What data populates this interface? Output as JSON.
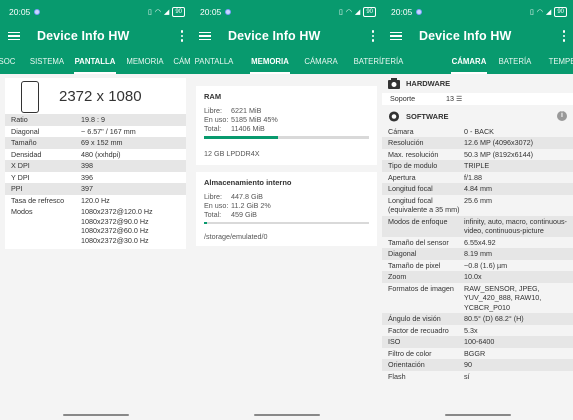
{
  "status": {
    "time": "20:05",
    "battery": "90"
  },
  "app_title": "Device Info HW",
  "panel1": {
    "tabs": [
      "SOC",
      "SISTEMA",
      "PANTALLA",
      "MEMORIA",
      "CÁMERA"
    ],
    "resolution": "2372 x 1080",
    "rows": [
      {
        "k": "Ratio",
        "v": "19.8 : 9"
      },
      {
        "k": "Diagonal",
        "v": "~ 6.57\" / 167 mm"
      },
      {
        "k": "Tamaño",
        "v": "69 x 152 mm"
      },
      {
        "k": "Densidad",
        "v": "480 (xxhdpi)"
      },
      {
        "k": "X DPI",
        "v": "398"
      },
      {
        "k": "Y DPI",
        "v": "396"
      },
      {
        "k": "PPI",
        "v": "397"
      },
      {
        "k": "Tasa de refresco",
        "v": "120.0 Hz"
      }
    ],
    "modes_label": "Modos",
    "modes": [
      "1080x2372@120.0 Hz",
      "1080x2372@90.0 Hz",
      "1080x2372@60.0 Hz",
      "1080x2372@30.0 Hz"
    ]
  },
  "panel2": {
    "tabs": [
      "PANTALLA",
      "MEMORIA",
      "CÁMARA",
      "BATERÍA"
    ],
    "ram_title": "RAM",
    "ram": [
      {
        "k": "Libre:",
        "v": "6221 MiB"
      },
      {
        "k": "En uso:",
        "v": "5185 MiB 45%"
      },
      {
        "k": "Total:",
        "v": "11406 MiB"
      }
    ],
    "ram_used_fraction": 0.45,
    "ram_type": "12 GB LPDDR4X",
    "storage_title": "Almacenamiento interno",
    "storage": [
      {
        "k": "Libre:",
        "v": "447.8 GiB"
      },
      {
        "k": "En uso:",
        "v": "11.2 GiB 2%"
      },
      {
        "k": "Total:",
        "v": "459 GiB"
      }
    ],
    "storage_used_fraction": 0.02,
    "storage_path": "/storage/emulated/0"
  },
  "panel3": {
    "tabs": [
      "BATERÍA",
      "CÁMARA",
      "BATERÍA",
      "TEMPE"
    ],
    "hardware_title": "HARDWARE",
    "soporte_k": "Soporte",
    "soporte_v": "13",
    "software_title": "SOFTWARE",
    "rows": [
      {
        "k": "Cámara",
        "v": "0 - BACK"
      },
      {
        "k": "Resolución",
        "v": "12.6 MP (4096x3072)"
      },
      {
        "k": "Max. resolución",
        "v": "50.3 MP (8192x6144)"
      },
      {
        "k": "Tipo de modulo",
        "v": "TRIPLE"
      },
      {
        "k": "Apertura",
        "v": "f/1.88"
      },
      {
        "k": "Longitud focal",
        "v": "4.84 mm"
      },
      {
        "k": "Longitud focal (equivalente a 35 mm)",
        "v": "25.6 mm"
      },
      {
        "k": "Modos de enfoque",
        "v": "infinity, auto, macro, continuous-video, continuous-picture"
      },
      {
        "k": "Tamaño del sensor",
        "v": "6.55x4.92"
      },
      {
        "k": "Diagonal",
        "v": "8.19 mm"
      },
      {
        "k": "Tamaño de pixel",
        "v": "~0.8 (1.6) µm"
      },
      {
        "k": "Zoom",
        "v": "10.0x"
      },
      {
        "k": "Formatos de imagen",
        "v": "RAW_SENSOR, JPEG, YUV_420_888, RAW10, YCBCR_P010"
      },
      {
        "k": "Ángulo de visión",
        "v": "80.5° (D) 68.2° (H)"
      },
      {
        "k": "Factor de recuadro",
        "v": "5.3x"
      },
      {
        "k": "ISO",
        "v": "100-6400"
      },
      {
        "k": "Filtro de color",
        "v": "BGGR"
      },
      {
        "k": "Orientación",
        "v": "90"
      },
      {
        "k": "Flash",
        "v": "sí"
      }
    ]
  }
}
